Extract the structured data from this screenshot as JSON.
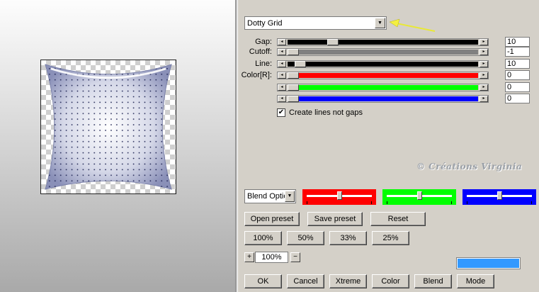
{
  "preset": {
    "selected": "Dotty Grid"
  },
  "parameters": [
    {
      "label": "Gap:",
      "value": "10",
      "fill": "#000000",
      "level": 0.22
    },
    {
      "label": "Cutoff:",
      "value": "-1",
      "fill": "#808080",
      "level": 0.0
    },
    {
      "label": "Line:",
      "value": "10",
      "fill": "#000000",
      "level": 0.04
    },
    {
      "label": "Color[R]:",
      "value": "0",
      "fill": "#ff0000",
      "level": 0.0
    },
    {
      "label": "",
      "value": "0",
      "fill": "#00ff00",
      "level": 0.0
    },
    {
      "label": "",
      "value": "0",
      "fill": "#0000ff",
      "level": 0.0
    }
  ],
  "checkbox": {
    "label": "Create lines not gaps",
    "checked": true,
    "mark": "✔"
  },
  "watermark": "© Créations Virginia",
  "blend": {
    "selected": "Blend Optio",
    "arrow": "▼"
  },
  "color_panels": [
    {
      "color": "#ff0000",
      "level": 0.5
    },
    {
      "color": "#00ff00",
      "level": 0.5
    },
    {
      "color": "#0000ff",
      "level": 0.5
    }
  ],
  "buttons": {
    "open_preset": "Open preset",
    "save_preset": "Save preset",
    "reset": "Reset",
    "zoom_100": "100%",
    "zoom_50": "50%",
    "zoom_33": "33%",
    "zoom_25": "25%",
    "ok": "OK",
    "cancel": "Cancel",
    "xtreme": "Xtreme",
    "color": "Color",
    "blend": "Blend",
    "mode": "Mode"
  },
  "zoom": {
    "value": "100%",
    "plus": "+",
    "minus": "−"
  },
  "swatch_color": "#3399ff",
  "icons": {
    "dropdown_arrow": "▼",
    "slider_left": "◂",
    "slider_right": "▸",
    "pointer": "yellow-arrow-icon"
  }
}
